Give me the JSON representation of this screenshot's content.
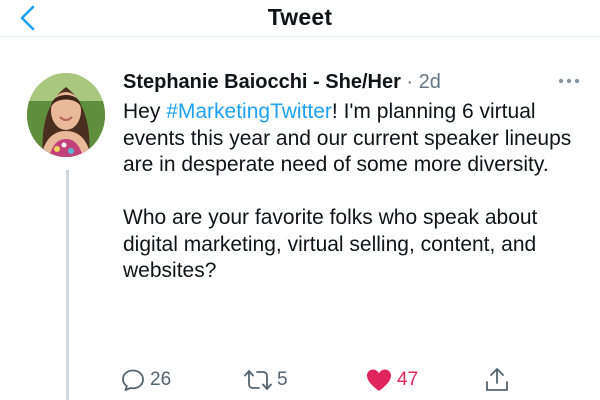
{
  "header": {
    "title": "Tweet",
    "back_icon": "chevron-left-icon",
    "accent_color": "#1da1f2"
  },
  "tweet": {
    "author_name": "Stephanie Baiocchi - She/Her",
    "separator": "·",
    "timestamp": "2d",
    "avatar_icon": "avatar",
    "more_icon": "more-horizontal-icon",
    "body": {
      "p1_before": "Hey ",
      "hashtag": "#MarketingTwitter",
      "p1_after": "! I'm planning 6 virtual events this year and our current speaker lineups are in desperate need of some more diversity.",
      "p2": "Who are your favorite folks who speak about digital marketing, virtual selling, content, and websites?"
    },
    "hashtag_color": "#1da1f2",
    "actions": {
      "reply_count": "26",
      "retweet_count": "5",
      "like_count": "47",
      "liked": true,
      "like_color": "#e0245e"
    }
  }
}
